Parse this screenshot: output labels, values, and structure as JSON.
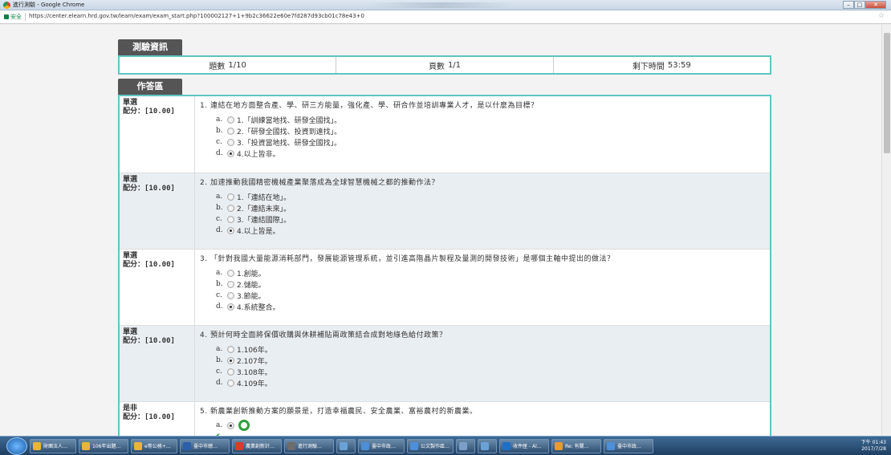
{
  "window": {
    "title": "進行測驗 - Google Chrome"
  },
  "address_bar": {
    "secure_label": "安全",
    "url": "https://center.elearn.hrd.gov.tw/learn/exam/exam_start.php?100002127+1+9b2c36622e60e7fd287d93cb01c78e43+0"
  },
  "exam_info": {
    "tab_label": "測驗資訊",
    "question_label": "題數",
    "question_value": "1/10",
    "page_label": "頁數",
    "page_value": "1/1",
    "time_label": "剩下時間",
    "time_value": "53:59"
  },
  "answer_area": {
    "tab_label": "作答區",
    "questions": [
      {
        "type": "單選",
        "score": "配分：[10.00]",
        "text": "1. 連結在地方面整合產、學、研三方能量，強化產、學、研合作並培訓專業人才，是以什麼為目標？",
        "options": [
          {
            "letter": "a.",
            "label": "1.「訓練當地找、研發全國找」。",
            "selected": false
          },
          {
            "letter": "b.",
            "label": "2.「研發全國找、投資到遠找」。",
            "selected": false
          },
          {
            "letter": "c.",
            "label": "3.「投資當地找、研發全國找」。",
            "selected": false
          },
          {
            "letter": "d.",
            "label": "4.以上皆非。",
            "selected": true
          }
        ]
      },
      {
        "type": "單選",
        "score": "配分：[10.00]",
        "text": "2. 加速推動我國精密機械產業聚落成為全球智慧機械之都的推動作法？",
        "options": [
          {
            "letter": "a.",
            "label": "1.「連結在地」。",
            "selected": false
          },
          {
            "letter": "b.",
            "label": "2.「連結未來」。",
            "selected": false
          },
          {
            "letter": "c.",
            "label": "3.「連結國際」。",
            "selected": false
          },
          {
            "letter": "d.",
            "label": "4.以上皆是。",
            "selected": true
          }
        ]
      },
      {
        "type": "單選",
        "score": "配分：[10.00]",
        "text": "3. 「針對我國大量能源消耗部門，發展能源管理系統，並引進高階晶片製程及量測的開發技術」是哪個主軸中提出的做法？",
        "options": [
          {
            "letter": "a.",
            "label": "1.創能。",
            "selected": false
          },
          {
            "letter": "b.",
            "label": "2.儲能。",
            "selected": false
          },
          {
            "letter": "c.",
            "label": "3.節能。",
            "selected": false
          },
          {
            "letter": "d.",
            "label": "4.系統整合。",
            "selected": true
          }
        ]
      },
      {
        "type": "單選",
        "score": "配分：[10.00]",
        "text": "4. 預計何時全面將保價收購與休耕補貼兩政策結合成對地綠色給付政策？",
        "options": [
          {
            "letter": "a.",
            "label": "1.106年。",
            "selected": false
          },
          {
            "letter": "b.",
            "label": "2.107年。",
            "selected": true
          },
          {
            "letter": "c.",
            "label": "3.108年。",
            "selected": false
          },
          {
            "letter": "d.",
            "label": "4.109年。",
            "selected": false
          }
        ]
      },
      {
        "type": "是非",
        "score": "配分：[10.00]",
        "text": "5. 新農業創新推動方案的願景是，打造幸福農民、安全農業、富裕農村的新農業。",
        "options": [
          {
            "letter": "a.",
            "label": "",
            "selected": true
          }
        ]
      }
    ]
  },
  "taskbar": {
    "items": [
      "財團法人…",
      "106年出題…",
      "e等公務+…",
      "臺中市總…",
      "農業創新計…",
      "進行測驗…",
      "",
      "臺中市政…",
      "公文製作區…",
      "",
      "",
      "收件匣 - Al…",
      "Re: 有關…",
      "臺中市政…"
    ],
    "clock_time": "下午 01:43",
    "clock_date": "2017/7/28"
  }
}
